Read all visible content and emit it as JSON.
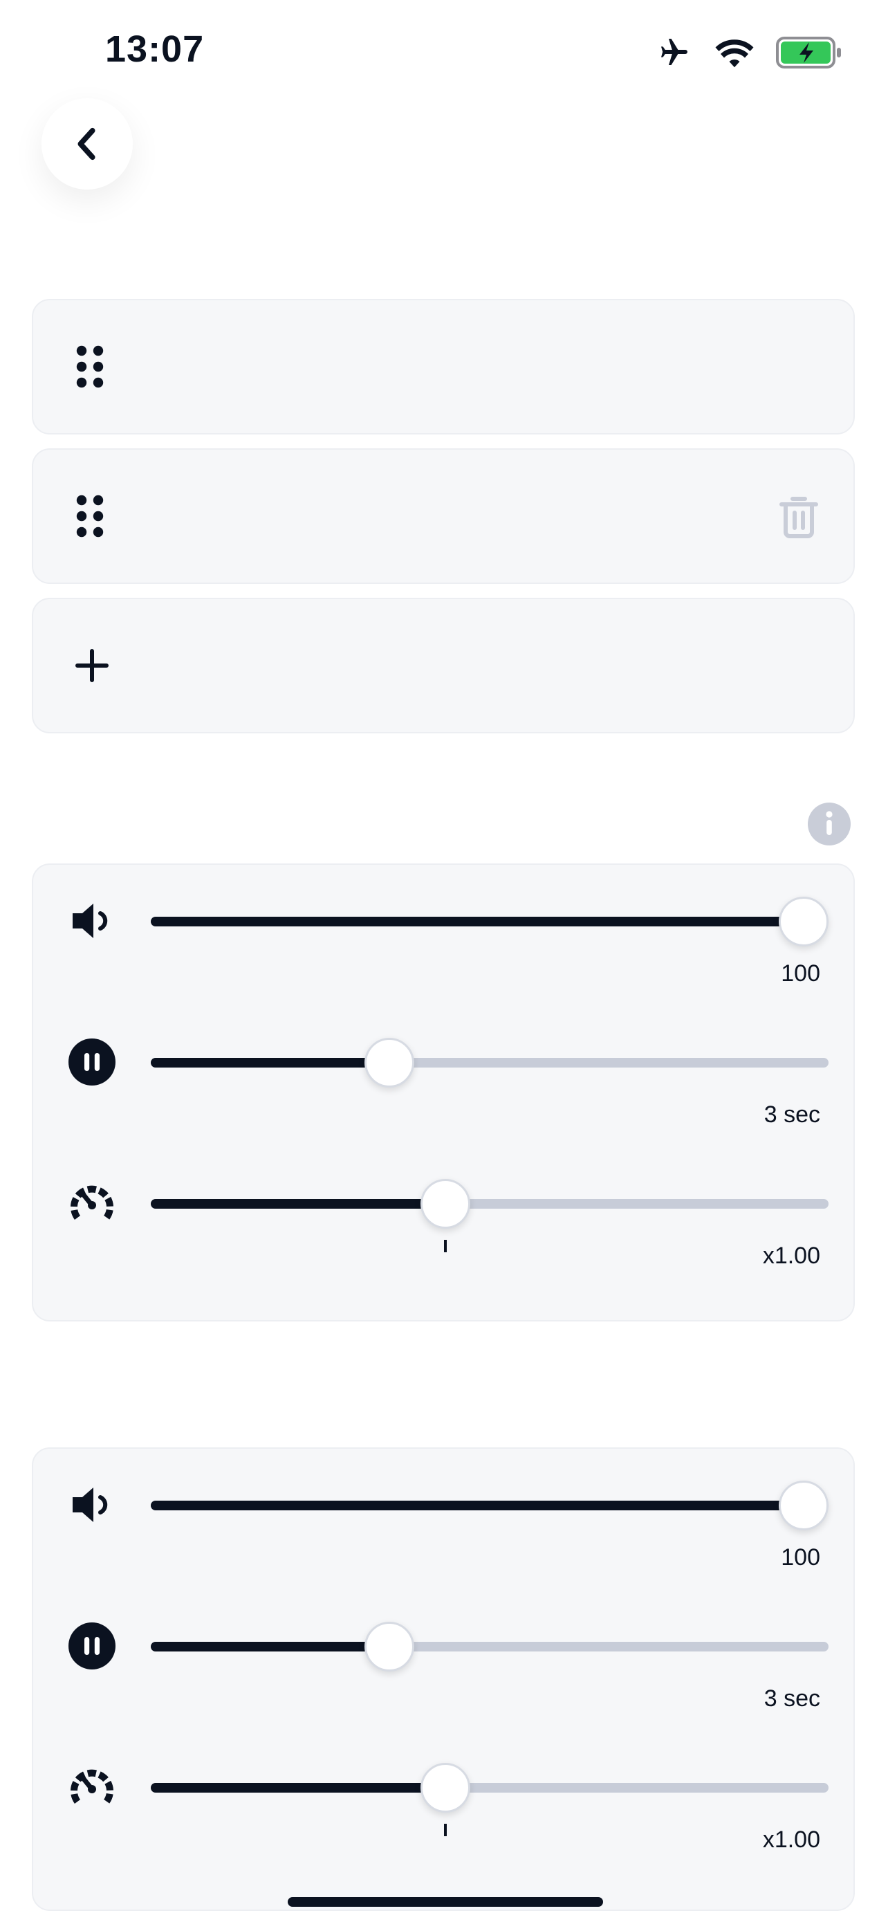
{
  "status_bar": {
    "time": "13:07",
    "icons": [
      "airplane-icon",
      "wifi-icon",
      "battery-charging-icon"
    ],
    "battery_color": "#34c759"
  },
  "back_button": {
    "icon": "chevron-left-icon"
  },
  "list": {
    "rows": [
      {
        "icon": "drag-handle-icon",
        "has_delete": false
      },
      {
        "icon": "drag-handle-icon",
        "has_delete": true,
        "delete_icon": "trash-icon"
      }
    ],
    "add_row": {
      "icon": "plus-icon"
    }
  },
  "info_button": {
    "icon": "info-icon"
  },
  "settings_groups": [
    {
      "volume": {
        "icon": "speaker-icon",
        "level": 1.0,
        "value_label": "100"
      },
      "pause": {
        "icon": "pause-icon",
        "level": 0.34,
        "value_label": "3 sec"
      },
      "speed": {
        "icon": "speedometer-icon",
        "level": 0.43,
        "default_mark": 0.43,
        "value_label": "x1.00"
      }
    },
    {
      "volume": {
        "icon": "speaker-icon",
        "level": 1.0,
        "value_label": "100"
      },
      "pause": {
        "icon": "pause-icon",
        "level": 0.34,
        "value_label": "3 sec"
      },
      "speed": {
        "icon": "speedometer-icon",
        "level": 0.43,
        "default_mark": 0.43,
        "value_label": "x1.00"
      }
    }
  ],
  "colors": {
    "track_active": "#0b1220",
    "track_inactive": "#c7ccd8",
    "card_bg": "#f6f7f9",
    "muted_icon": "#c9cdd8"
  }
}
